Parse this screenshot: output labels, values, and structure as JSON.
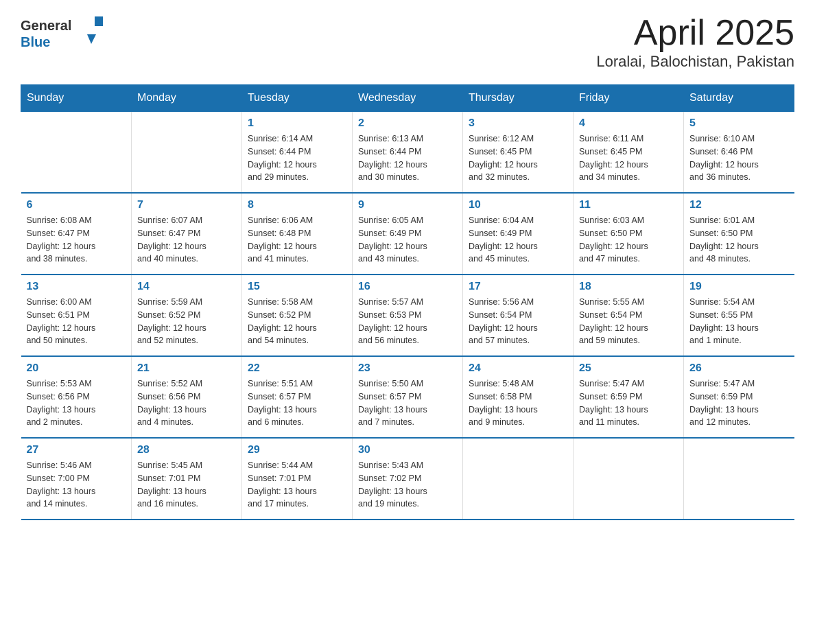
{
  "header": {
    "logo_general": "General",
    "logo_blue": "Blue",
    "title": "April 2025",
    "subtitle": "Loralai, Balochistan, Pakistan"
  },
  "days_of_week": [
    "Sunday",
    "Monday",
    "Tuesday",
    "Wednesday",
    "Thursday",
    "Friday",
    "Saturday"
  ],
  "weeks": [
    [
      {
        "day": "",
        "info": ""
      },
      {
        "day": "",
        "info": ""
      },
      {
        "day": "1",
        "info": "Sunrise: 6:14 AM\nSunset: 6:44 PM\nDaylight: 12 hours\nand 29 minutes."
      },
      {
        "day": "2",
        "info": "Sunrise: 6:13 AM\nSunset: 6:44 PM\nDaylight: 12 hours\nand 30 minutes."
      },
      {
        "day": "3",
        "info": "Sunrise: 6:12 AM\nSunset: 6:45 PM\nDaylight: 12 hours\nand 32 minutes."
      },
      {
        "day": "4",
        "info": "Sunrise: 6:11 AM\nSunset: 6:45 PM\nDaylight: 12 hours\nand 34 minutes."
      },
      {
        "day": "5",
        "info": "Sunrise: 6:10 AM\nSunset: 6:46 PM\nDaylight: 12 hours\nand 36 minutes."
      }
    ],
    [
      {
        "day": "6",
        "info": "Sunrise: 6:08 AM\nSunset: 6:47 PM\nDaylight: 12 hours\nand 38 minutes."
      },
      {
        "day": "7",
        "info": "Sunrise: 6:07 AM\nSunset: 6:47 PM\nDaylight: 12 hours\nand 40 minutes."
      },
      {
        "day": "8",
        "info": "Sunrise: 6:06 AM\nSunset: 6:48 PM\nDaylight: 12 hours\nand 41 minutes."
      },
      {
        "day": "9",
        "info": "Sunrise: 6:05 AM\nSunset: 6:49 PM\nDaylight: 12 hours\nand 43 minutes."
      },
      {
        "day": "10",
        "info": "Sunrise: 6:04 AM\nSunset: 6:49 PM\nDaylight: 12 hours\nand 45 minutes."
      },
      {
        "day": "11",
        "info": "Sunrise: 6:03 AM\nSunset: 6:50 PM\nDaylight: 12 hours\nand 47 minutes."
      },
      {
        "day": "12",
        "info": "Sunrise: 6:01 AM\nSunset: 6:50 PM\nDaylight: 12 hours\nand 48 minutes."
      }
    ],
    [
      {
        "day": "13",
        "info": "Sunrise: 6:00 AM\nSunset: 6:51 PM\nDaylight: 12 hours\nand 50 minutes."
      },
      {
        "day": "14",
        "info": "Sunrise: 5:59 AM\nSunset: 6:52 PM\nDaylight: 12 hours\nand 52 minutes."
      },
      {
        "day": "15",
        "info": "Sunrise: 5:58 AM\nSunset: 6:52 PM\nDaylight: 12 hours\nand 54 minutes."
      },
      {
        "day": "16",
        "info": "Sunrise: 5:57 AM\nSunset: 6:53 PM\nDaylight: 12 hours\nand 56 minutes."
      },
      {
        "day": "17",
        "info": "Sunrise: 5:56 AM\nSunset: 6:54 PM\nDaylight: 12 hours\nand 57 minutes."
      },
      {
        "day": "18",
        "info": "Sunrise: 5:55 AM\nSunset: 6:54 PM\nDaylight: 12 hours\nand 59 minutes."
      },
      {
        "day": "19",
        "info": "Sunrise: 5:54 AM\nSunset: 6:55 PM\nDaylight: 13 hours\nand 1 minute."
      }
    ],
    [
      {
        "day": "20",
        "info": "Sunrise: 5:53 AM\nSunset: 6:56 PM\nDaylight: 13 hours\nand 2 minutes."
      },
      {
        "day": "21",
        "info": "Sunrise: 5:52 AM\nSunset: 6:56 PM\nDaylight: 13 hours\nand 4 minutes."
      },
      {
        "day": "22",
        "info": "Sunrise: 5:51 AM\nSunset: 6:57 PM\nDaylight: 13 hours\nand 6 minutes."
      },
      {
        "day": "23",
        "info": "Sunrise: 5:50 AM\nSunset: 6:57 PM\nDaylight: 13 hours\nand 7 minutes."
      },
      {
        "day": "24",
        "info": "Sunrise: 5:48 AM\nSunset: 6:58 PM\nDaylight: 13 hours\nand 9 minutes."
      },
      {
        "day": "25",
        "info": "Sunrise: 5:47 AM\nSunset: 6:59 PM\nDaylight: 13 hours\nand 11 minutes."
      },
      {
        "day": "26",
        "info": "Sunrise: 5:47 AM\nSunset: 6:59 PM\nDaylight: 13 hours\nand 12 minutes."
      }
    ],
    [
      {
        "day": "27",
        "info": "Sunrise: 5:46 AM\nSunset: 7:00 PM\nDaylight: 13 hours\nand 14 minutes."
      },
      {
        "day": "28",
        "info": "Sunrise: 5:45 AM\nSunset: 7:01 PM\nDaylight: 13 hours\nand 16 minutes."
      },
      {
        "day": "29",
        "info": "Sunrise: 5:44 AM\nSunset: 7:01 PM\nDaylight: 13 hours\nand 17 minutes."
      },
      {
        "day": "30",
        "info": "Sunrise: 5:43 AM\nSunset: 7:02 PM\nDaylight: 13 hours\nand 19 minutes."
      },
      {
        "day": "",
        "info": ""
      },
      {
        "day": "",
        "info": ""
      },
      {
        "day": "",
        "info": ""
      }
    ]
  ]
}
